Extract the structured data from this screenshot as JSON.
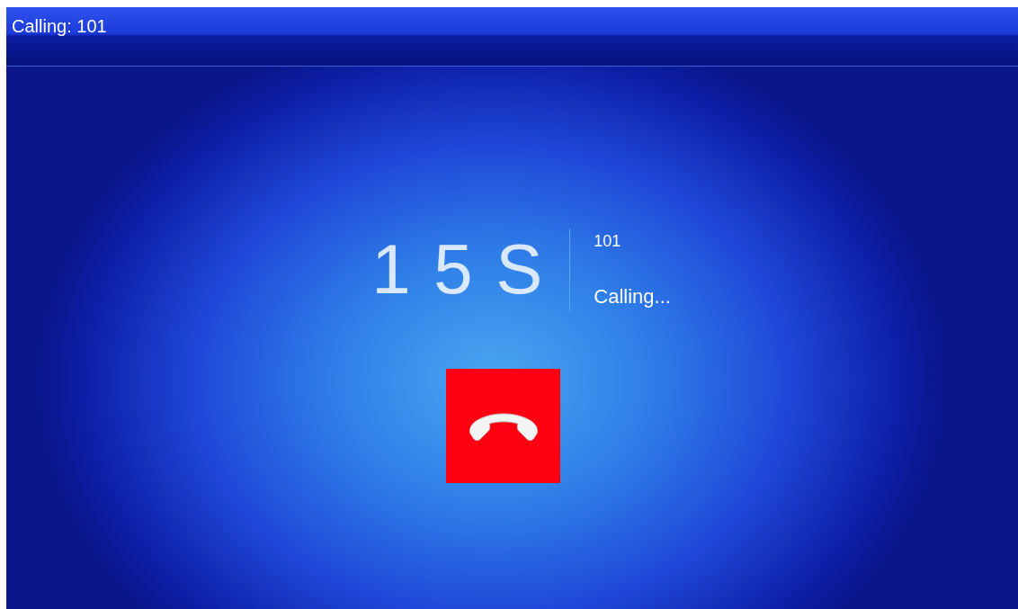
{
  "title_bar": {
    "title": "Calling: 101"
  },
  "call": {
    "timer": "1 5 S",
    "number": "101",
    "status": "Calling..."
  },
  "hangup_button": {
    "kind": "end-call"
  }
}
